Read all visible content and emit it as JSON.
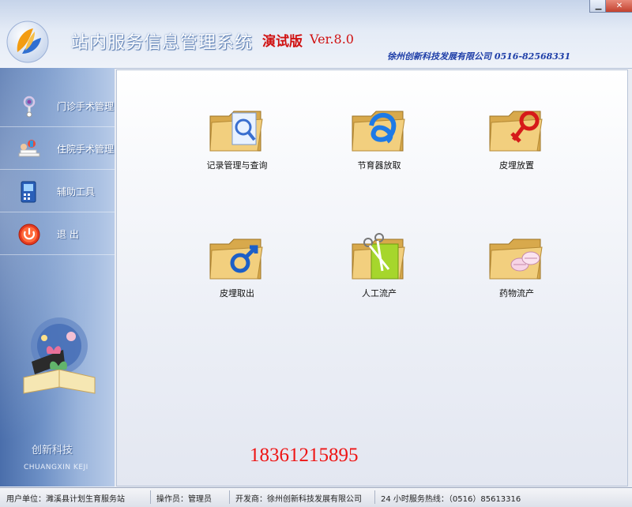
{
  "window": {
    "minimize_symbol": "▁",
    "close_symbol": "✕"
  },
  "header": {
    "title": "站内服务信息管理系统",
    "edition": "演试版",
    "version": "Ver.8.0",
    "company_line": "徐州创新科技发展有限公司 0516-82568331",
    "logo_icon": "leaf-logo-icon"
  },
  "sidebar": {
    "items": [
      {
        "label": "门诊手术管理",
        "icon": "medical-stethoscope-icon"
      },
      {
        "label": "住院手术管理",
        "icon": "hospital-bed-icon"
      },
      {
        "label": "辅助工具",
        "icon": "tool-device-icon"
      },
      {
        "label": "退  出",
        "icon": "power-icon"
      }
    ],
    "brand_cn": "创新科技",
    "brand_en": "CHUANGXIN KEJI"
  },
  "main": {
    "tiles": [
      {
        "label": "记录管理与查询",
        "icon": "folder-search-icon"
      },
      {
        "label": "节育器放取",
        "icon": "folder-knot-icon"
      },
      {
        "label": "皮埋放置",
        "icon": "folder-female-icon"
      },
      {
        "label": "皮埋取出",
        "icon": "folder-male-icon"
      },
      {
        "label": "人工流产",
        "icon": "folder-scissors-icon"
      },
      {
        "label": "药物流产",
        "icon": "folder-pills-icon"
      }
    ],
    "phone": "18361215895"
  },
  "status_bar": {
    "user_unit": "用户单位：濉溪县计划生育服务站",
    "operator": "操作员：管理员",
    "developer": "开发商：徐州创新科技发展有限公司",
    "hotline": "24 小时服务热线：（0516）85613316"
  },
  "colors": {
    "accent_red": "#d01212",
    "company_blue": "#1f3fa8",
    "phone_red": "#ee1515",
    "sidebar_blue": "#6c8fc5"
  }
}
